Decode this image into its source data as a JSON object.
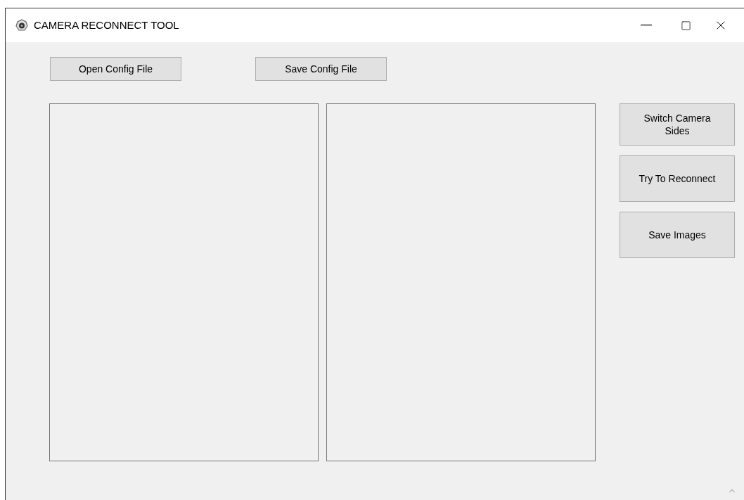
{
  "window": {
    "title": "CAMERA RECONNECT TOOL"
  },
  "top_buttons": [
    "Open Config File",
    "Save Config File"
  ],
  "side_buttons": [
    {
      "label": "Switch Camera Sides"
    },
    {
      "label": "Try To Reconnect"
    },
    {
      "label": "Save Images"
    }
  ]
}
